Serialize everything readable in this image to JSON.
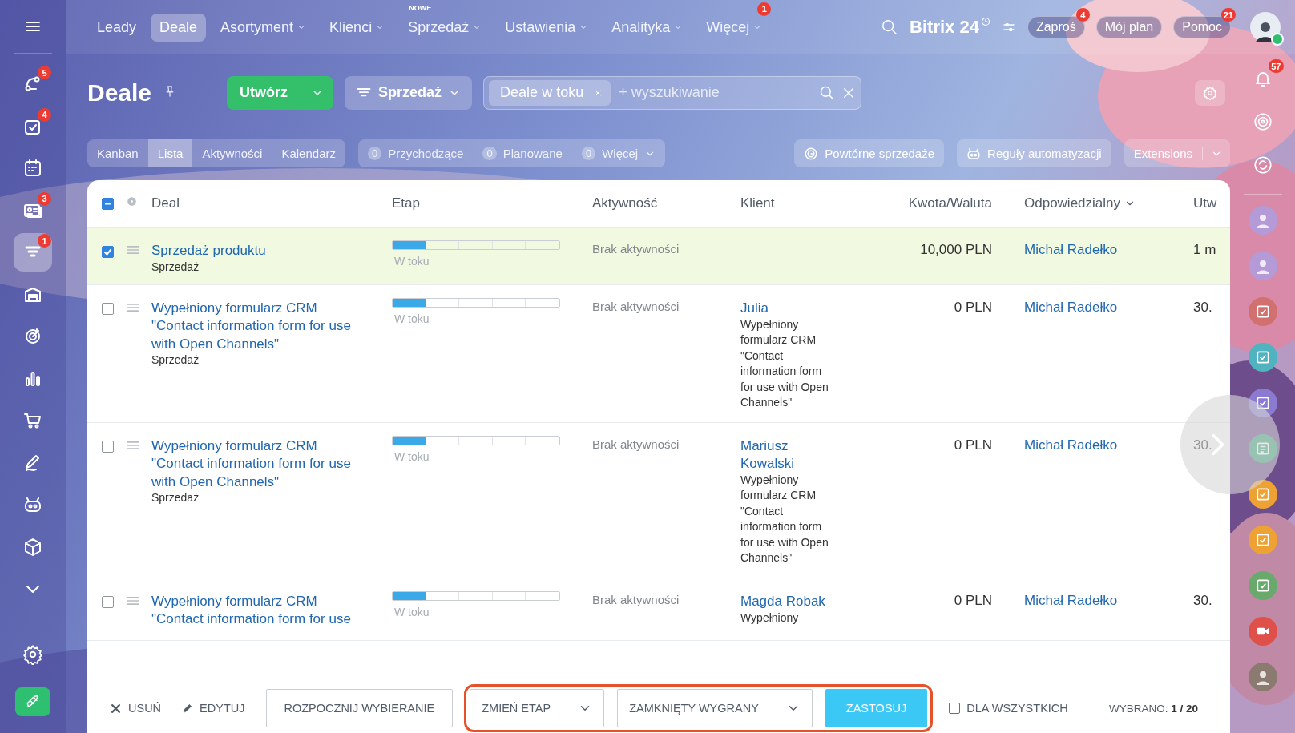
{
  "nav": {
    "items": [
      {
        "label": "Leady",
        "selected": false,
        "dropdown": false
      },
      {
        "label": "Deale",
        "selected": true,
        "dropdown": false
      },
      {
        "label": "Asortyment",
        "selected": false,
        "dropdown": true
      },
      {
        "label": "Klienci",
        "selected": false,
        "dropdown": true
      },
      {
        "label": "Sprzedaż",
        "selected": false,
        "dropdown": true,
        "tag": "NOWE"
      },
      {
        "label": "Ustawienia",
        "selected": false,
        "dropdown": true
      },
      {
        "label": "Analityka",
        "selected": false,
        "dropdown": true
      },
      {
        "label": "Więcej",
        "selected": false,
        "dropdown": true,
        "badge": "1"
      }
    ],
    "logo": "Bitrix 24",
    "buttons": [
      {
        "label": "Zaproś",
        "badge": "4"
      },
      {
        "label": "Mój plan"
      },
      {
        "label": "Pomoc",
        "badge": "21"
      }
    ]
  },
  "sidebar": {
    "items": [
      {
        "kind": "flow",
        "badge": "5",
        "selected": false
      },
      {
        "kind": "tasks",
        "badge": "4",
        "selected": false
      },
      {
        "kind": "calendar",
        "selected": false
      },
      {
        "kind": "contacts",
        "badge": "3",
        "selected": false
      },
      {
        "kind": "funnel",
        "badge": "1",
        "selected": true
      },
      {
        "kind": "warehouse",
        "selected": false
      },
      {
        "kind": "target",
        "selected": false
      },
      {
        "kind": "analytics",
        "selected": false
      },
      {
        "kind": "cart",
        "selected": false
      },
      {
        "kind": "sign",
        "selected": false
      },
      {
        "kind": "robot",
        "selected": false
      },
      {
        "kind": "box",
        "selected": false
      },
      {
        "kind": "more",
        "selected": false
      }
    ]
  },
  "page": {
    "title": "Deale",
    "create_button": "Utwórz",
    "pipeline": "Sprzedaż",
    "search": {
      "tag": "Deale w toku",
      "placeholder": "+ wyszukiwanie"
    }
  },
  "views": [
    {
      "label": "Kanban",
      "selected": false
    },
    {
      "label": "Lista",
      "selected": true
    },
    {
      "label": "Aktywności",
      "selected": false
    },
    {
      "label": "Kalendarz",
      "selected": false
    }
  ],
  "counters": [
    {
      "count": "0",
      "label": "Przychodzące",
      "dropdown": false
    },
    {
      "count": "0",
      "label": "Planowane",
      "dropdown": false
    },
    {
      "count": "0",
      "label": "Więcej",
      "dropdown": true
    }
  ],
  "actions": [
    {
      "kind": "repeat",
      "label": "Powtórne sprzedaże"
    },
    {
      "kind": "robot",
      "label": "Reguły automatyzacji"
    },
    {
      "kind": "split",
      "label": "Extensions"
    }
  ],
  "table": {
    "indeterminate": true,
    "columns": [
      {
        "label": "Deal",
        "dropdown": false
      },
      {
        "label": "Etap",
        "dropdown": false
      },
      {
        "label": "Aktywność",
        "dropdown": false
      },
      {
        "label": "Klient",
        "dropdown": false
      },
      {
        "label": "Kwota/Waluta",
        "dropdown": false
      },
      {
        "label": "Odpowiedzialny",
        "dropdown": true
      },
      {
        "label": "Utw",
        "dropdown": false
      }
    ],
    "rows": [
      {
        "checked": true,
        "selected": true,
        "title": "Sprzedaż produktu",
        "pipeline": "Sprzedaż",
        "stage": {
          "level": 0.2,
          "label": "W toku"
        },
        "activity": "Brak aktywności",
        "amount": "10,000 PLN",
        "responsible": "Michał Radełko",
        "created": "1 m"
      },
      {
        "checked": false,
        "selected": false,
        "title": "Wypełniony formularz CRM \"Contact information form for use with Open Channels\"",
        "pipeline": "Sprzedaż",
        "stage": {
          "level": 0.2,
          "label": "W toku"
        },
        "activity": "Brak aktywności",
        "client": {
          "name": "Julia",
          "note": "Wypełniony formularz CRM \"Contact information form for use with Open Channels\""
        },
        "amount": "0 PLN",
        "responsible": "Michał Radełko",
        "created": "30."
      },
      {
        "checked": false,
        "selected": false,
        "title": "Wypełniony formularz CRM \"Contact information form for use with Open Channels\"",
        "pipeline": "Sprzedaż",
        "stage": {
          "level": 0.2,
          "label": "W toku"
        },
        "activity": "Brak aktywności",
        "client": {
          "name": "Mariusz Kowalski",
          "note": "Wypełniony formularz CRM \"Contact information form for use with Open Channels\""
        },
        "amount": "0 PLN",
        "responsible": "Michał Radełko",
        "created": "30."
      },
      {
        "checked": false,
        "selected": false,
        "title": "Wypełniony formularz CRM \"Contact information form for use",
        "stage": {
          "level": 0.2,
          "label": "W toku"
        },
        "activity": "Brak aktywności",
        "client": {
          "name": "Magda Robak",
          "note": "Wypełniony"
        },
        "amount": "0 PLN",
        "responsible": "Michał Radełko",
        "created": "30."
      }
    ]
  },
  "bottom_bar": {
    "delete": "USUŃ",
    "edit": "EDYTUJ",
    "dial": "ROZPOCZNIJ WYBIERANIE",
    "mass_edit": {
      "highlighted": true,
      "stage_select": "ZMIEŃ ETAP",
      "value_select": "ZAMKNIĘTY WYGRANY",
      "apply": "ZASTOSUJ"
    },
    "for_all": {
      "label": "DLA WSZYSTKICH",
      "checked": false
    },
    "selected_count": "WYBRANO: **1 / 20**"
  },
  "right_bar": {
    "notifications": "57"
  }
}
